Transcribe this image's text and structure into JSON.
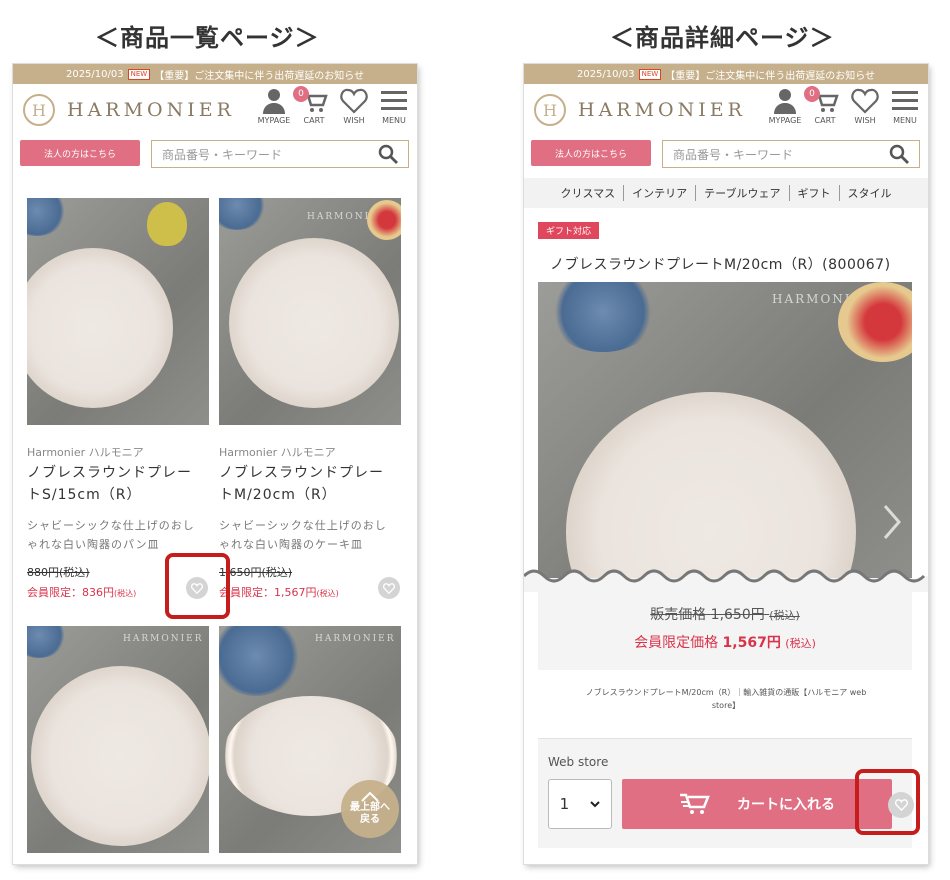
{
  "headings": {
    "list": "＜商品一覧ページ＞",
    "detail": "＜商品詳細ページ＞"
  },
  "notice": {
    "date": "2025/10/03",
    "new_badge": "NEW",
    "text": "【重要】ご注文集中に伴う出荷遅延のお知らせ"
  },
  "header": {
    "logo_text": "HARMONIER",
    "logo_mark": "H",
    "nav": {
      "mypage": "MYPAGE",
      "cart": "CART",
      "wish": "WISH",
      "menu": "MENU"
    },
    "cart_count": "0"
  },
  "search": {
    "corporate_button": "法人の方はこちら",
    "placeholder": "商品番号・キーワード"
  },
  "watermark": "HARMONIER",
  "list": {
    "products": [
      {
        "brand": "Harmonier ハルモニア",
        "name_line1": "ノブレスラウンドプレー",
        "name_line2": "トS/15cm（R）",
        "desc_line1": "シャビーシックな仕上げのおし",
        "desc_line2": "ゃれな白い陶器のパン皿",
        "old_price": "880円(税込)",
        "member_price": "会員限定：836円",
        "tax_note": "(税込)"
      },
      {
        "brand": "Harmonier ハルモニア",
        "name_line1": "ノブレスラウンドプレー",
        "name_line2": "トM/20cm（R）",
        "desc_line1": "シャビーシックな仕上げのおし",
        "desc_line2": "ゃれな白い陶器のケーキ皿",
        "old_price": "1,650円(税込)",
        "member_price": "会員限定：1,567円",
        "tax_note": "(税込)"
      }
    ],
    "back_to_top": {
      "line1": "最上部へ",
      "line2": "戻る"
    }
  },
  "detail": {
    "categories": [
      "クリスマス",
      "インテリア",
      "テーブルウェア",
      "ギフト",
      "スタイル"
    ],
    "gift_tag": "ギフト対応",
    "title": "ノブレスラウンドプレートM/20cm（R）(800067)",
    "price_label": "販売価格",
    "price": "1,650円",
    "price_tax": "(税込)",
    "member_label": "会員限定価格",
    "member_price": "1,567円",
    "member_tax": "(税込)",
    "breadcrumb_line1": "ノブレスラウンドプレートM/20cm（R）｜輸入雑貨の通販【ハルモニア web",
    "breadcrumb_line2": "store】",
    "store_label": "Web store",
    "quantity": "1",
    "add_to_cart": "カートに入れる"
  }
}
